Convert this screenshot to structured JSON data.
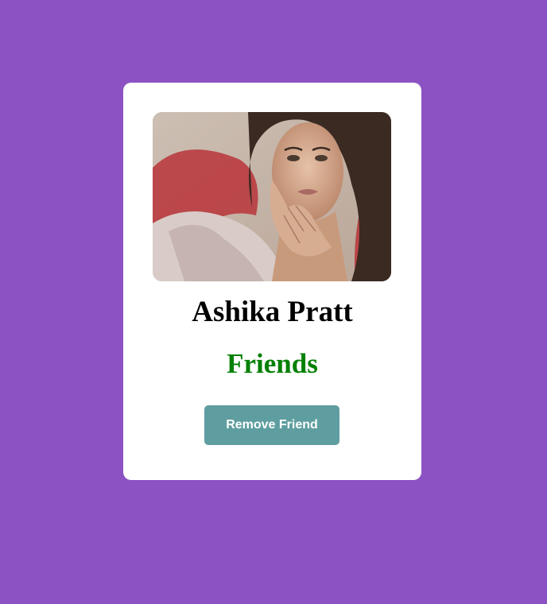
{
  "profile": {
    "name": "Ashika Pratt",
    "status": "Friends",
    "status_color": "#008000",
    "photo_alt": "Ashika Pratt"
  },
  "actions": {
    "remove_label": "Remove Friend",
    "remove_color": "#5f9ea0"
  },
  "theme": {
    "background": "#8c52c3",
    "card": "#ffffff"
  }
}
